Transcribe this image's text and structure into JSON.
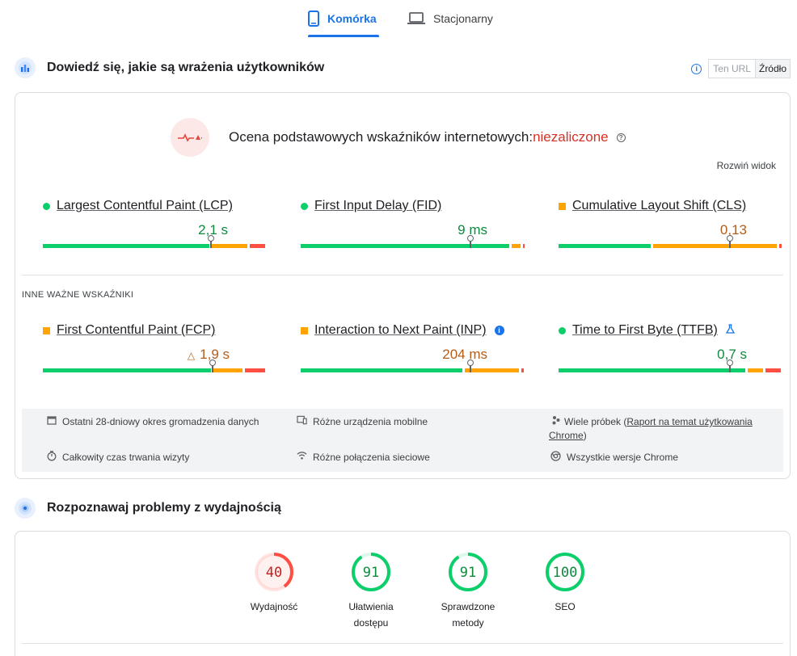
{
  "tabs": [
    {
      "label": "Komórka",
      "icon": "smartphone-icon",
      "active": true
    },
    {
      "label": "Stacjonarny",
      "icon": "laptop-icon",
      "active": false
    }
  ],
  "crux": {
    "title": "Dowiedź się, jakie są wrażenia użytkowników",
    "toggle": {
      "this_url": "Ten URL",
      "origin": "Źródło"
    },
    "assessment_label": "Ocena podstawowych wskaźników internetowych: ",
    "assessment_status": "niezaliczone",
    "expand": "Rozwiń widok",
    "core_metrics": [
      {
        "name": "Largest Contentful Paint (LCP)",
        "value": "2,1 s",
        "status": "good",
        "marker_fraction": 0.745,
        "dist": [
          0.75,
          0.17,
          0.08
        ]
      },
      {
        "name": "First Input Delay (FID)",
        "value": "9 ms",
        "status": "good",
        "marker_fraction": 0.75,
        "dist": [
          0.94,
          0.05,
          0.01
        ]
      },
      {
        "name": "Cumulative Layout Shift (CLS)",
        "value": "0,13",
        "status": "average",
        "marker_fraction": 0.76,
        "dist": [
          0.42,
          0.56,
          0.02
        ]
      }
    ],
    "other_label": "INNE WAŻNE WSKAŹNIKI",
    "other_metrics": [
      {
        "name": "First Contentful Paint (FCP)",
        "value": "1,9 s",
        "status": "average",
        "marker_fraction": 0.75,
        "dist": [
          0.76,
          0.14,
          0.1
        ]
      },
      {
        "name": "Interaction to Next Paint (INP)",
        "value": "204 ms",
        "status": "average",
        "marker_fraction": 0.75,
        "dist": [
          0.73,
          0.25,
          0.02
        ]
      },
      {
        "name": "Time to First Byte (TTFB)",
        "value": "0,7 s",
        "status": "good",
        "marker_fraction": 0.76,
        "dist": [
          0.84,
          0.08,
          0.08
        ]
      }
    ],
    "info": [
      {
        "icon": "calendar-icon",
        "text": "Ostatni 28-dniowy okres gromadzenia danych"
      },
      {
        "icon": "devices-icon",
        "text": "Różne urządzenia mobilne"
      },
      {
        "icon": "people-icon",
        "text_pre": "Wiele próbek (",
        "link": "Raport na temat użytkowania Chrome",
        "text_post": ")"
      },
      {
        "icon": "timer-icon",
        "text": "Całkowity czas trwania wizyty"
      },
      {
        "icon": "wifi-icon",
        "text": "Różne połączenia sieciowe"
      },
      {
        "icon": "chrome-icon",
        "text": "Wszystkie wersje Chrome"
      }
    ]
  },
  "diagnose": {
    "title": "Rozpoznawaj problemy z wydajnością",
    "scores": [
      {
        "value": "40",
        "label1": "Wydajność",
        "label2": "",
        "color": "#ff4e42",
        "bg": "#fff1f0",
        "text": "#c5221f",
        "score": 40
      },
      {
        "value": "91",
        "label1": "Ułatwienia",
        "label2": "dostępu",
        "color": "#0cce6b",
        "bg": "#ffffff",
        "text": "#0d8a3e",
        "score": 91
      },
      {
        "value": "91",
        "label1": "Sprawdzone",
        "label2": "metody",
        "color": "#0cce6b",
        "bg": "#ffffff",
        "text": "#0d8a3e",
        "score": 91
      },
      {
        "value": "100",
        "label1": "SEO",
        "label2": "",
        "color": "#0cce6b",
        "bg": "#ffffff",
        "text": "#0d8a3e",
        "score": 100
      }
    ]
  },
  "colors": {
    "good": "#0cce6b",
    "average": "#ffa400",
    "poor": "#ff4e42",
    "accent": "#1a73e8"
  }
}
